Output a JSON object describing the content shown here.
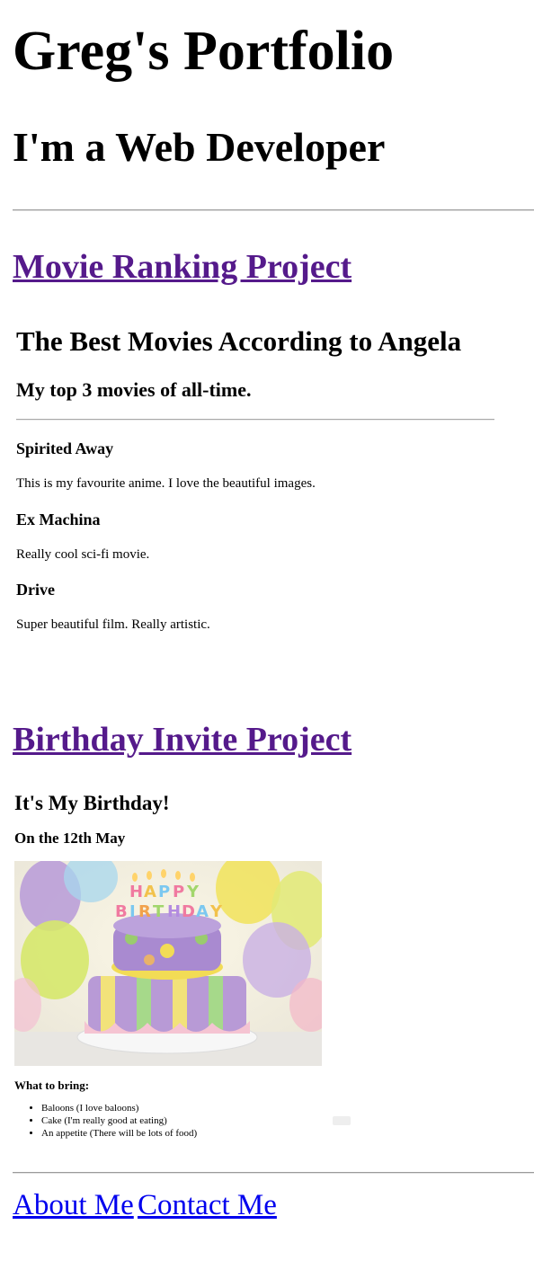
{
  "header": {
    "title": "Greg's Portfolio",
    "subtitle": "I'm a Web Developer"
  },
  "projects": [
    {
      "link_label": "Movie Ranking Project",
      "frame": {
        "title": "The Best Movies According to Angela",
        "subtitle": "My top 3 movies of all-time.",
        "movies": [
          {
            "title": "Spirited Away",
            "description": "This is my favourite anime. I love the beautiful images."
          },
          {
            "title": "Ex Machina",
            "description": "Really cool sci-fi movie."
          },
          {
            "title": "Drive",
            "description": "Super beautiful film. Really artistic."
          }
        ]
      }
    },
    {
      "link_label": "Birthday Invite Project",
      "frame": {
        "title": "It's My Birthday!",
        "subtitle": "On the 12th May",
        "image_icon": "birthday-cake-image",
        "bring_label": "What to bring:",
        "items": [
          "Baloons (I love baloons)",
          "Cake (I'm really good at eating)",
          "An appetite (There will be lots of food)"
        ]
      }
    }
  ],
  "footer": {
    "about_label": "About Me",
    "contact_label": "Contact Me"
  },
  "colors": {
    "visited_link": "#551a8b",
    "link": "#0000ee"
  }
}
